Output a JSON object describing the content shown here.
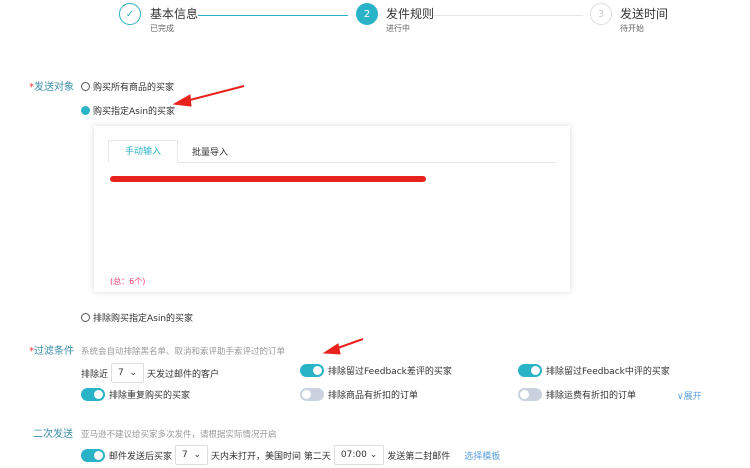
{
  "steps": [
    {
      "num": "✓",
      "title": "基本信息",
      "status": "已完成"
    },
    {
      "num": "2",
      "title": "发件规则",
      "status": "进行中"
    },
    {
      "num": "3",
      "title": "发送时间",
      "status": "待开始"
    }
  ],
  "target": {
    "label": "发送对象",
    "options": [
      "购买所有商品的买家",
      "购买指定Asin的买家",
      "排除购买指定Asin的买家"
    ],
    "selected": 1,
    "tabs": [
      "手动输入",
      "批量导入"
    ],
    "count": "(总：6个)"
  },
  "filter": {
    "label": "过滤条件",
    "hint": "系统会自动排除黑名单、取消和索评助手索评过的订单",
    "exclude_prefix": "排除近",
    "days": "7",
    "exclude_suffix": "天发过邮件的客户",
    "toggles": [
      {
        "label": "排除留过Feedback差评的买家",
        "on": true
      },
      {
        "label": "排除留过Feedback中评的买家",
        "on": true
      },
      {
        "label": "排除重复购买的买家",
        "on": true
      },
      {
        "label": "排除商品有折扣的订单",
        "on": false
      },
      {
        "label": "排除运费有折扣的订单",
        "on": false
      }
    ],
    "expand": "∨展开"
  },
  "resend": {
    "label": "二次发送",
    "hint": "亚马逊不建议给买家多次发件，请根据实际情况开启",
    "prefix": "邮件发送后买家",
    "days": "7",
    "mid": "天内未打开，美国时间 第二天",
    "time": "07:00",
    "suffix": "发送第二封邮件",
    "template_link": "选择模板"
  },
  "colors": {
    "accent": "#2ab3c7",
    "annotation": "#e8231e"
  }
}
